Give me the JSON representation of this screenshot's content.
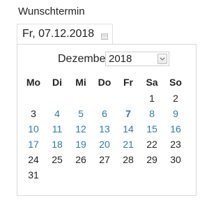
{
  "field": {
    "label": "Wunschtermin",
    "value": "Fr, 07.12.2018",
    "icon": "calendar-icon"
  },
  "picker": {
    "month": "Dezember",
    "year": "2018",
    "weekdays": [
      "Mo",
      "Di",
      "Mi",
      "Do",
      "Fr",
      "Sa",
      "So"
    ],
    "weeks": [
      [
        {
          "day": ""
        },
        {
          "day": ""
        },
        {
          "day": ""
        },
        {
          "day": ""
        },
        {
          "day": ""
        },
        {
          "day": "1",
          "state": "disabled"
        },
        {
          "day": "2",
          "state": "disabled"
        }
      ],
      [
        {
          "day": "3",
          "state": "disabled"
        },
        {
          "day": "4",
          "state": "enabled"
        },
        {
          "day": "5",
          "state": "enabled"
        },
        {
          "day": "6",
          "state": "enabled"
        },
        {
          "day": "7",
          "state": "selected"
        },
        {
          "day": "8",
          "state": "enabled"
        },
        {
          "day": "9",
          "state": "enabled"
        }
      ],
      [
        {
          "day": "10",
          "state": "enabled"
        },
        {
          "day": "11",
          "state": "enabled"
        },
        {
          "day": "12",
          "state": "enabled"
        },
        {
          "day": "13",
          "state": "enabled"
        },
        {
          "day": "14",
          "state": "enabled"
        },
        {
          "day": "15",
          "state": "enabled"
        },
        {
          "day": "16",
          "state": "enabled"
        }
      ],
      [
        {
          "day": "17",
          "state": "enabled"
        },
        {
          "day": "18",
          "state": "enabled"
        },
        {
          "day": "19",
          "state": "enabled"
        },
        {
          "day": "20",
          "state": "enabled"
        },
        {
          "day": "21",
          "state": "enabled"
        },
        {
          "day": "22",
          "state": "disabled"
        },
        {
          "day": "23",
          "state": "disabled"
        }
      ],
      [
        {
          "day": "24",
          "state": "disabled"
        },
        {
          "day": "25",
          "state": "disabled"
        },
        {
          "day": "26",
          "state": "disabled"
        },
        {
          "day": "27",
          "state": "disabled"
        },
        {
          "day": "28",
          "state": "disabled"
        },
        {
          "day": "29",
          "state": "disabled"
        },
        {
          "day": "30",
          "state": "disabled"
        }
      ],
      [
        {
          "day": "31",
          "state": "disabled"
        },
        {
          "day": ""
        },
        {
          "day": ""
        },
        {
          "day": ""
        },
        {
          "day": ""
        },
        {
          "day": ""
        },
        {
          "day": ""
        }
      ]
    ]
  },
  "colors": {
    "enabled_day": "#2a7ab5",
    "disabled_day": "#222222",
    "border": "#d9d9d9"
  }
}
